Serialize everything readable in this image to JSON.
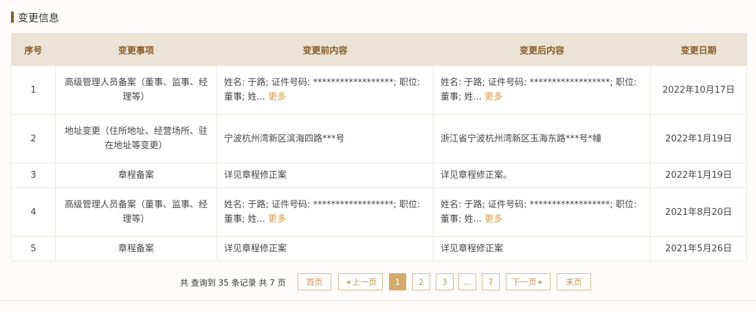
{
  "section": {
    "title": "变更信息"
  },
  "table": {
    "headers": {
      "index": "序号",
      "item": "变更事项",
      "before": "变更前内容",
      "after": "变更后内容",
      "date": "变更日期"
    },
    "more_label": "更多",
    "rows": [
      {
        "index": "1",
        "item": "高级管理人员备案（董事、监事、经理等）",
        "before": "姓名: 于路; 证件号码: ******************; 职位: 董事; 姓...",
        "after": "姓名: 于路; 证件号码: ******************; 职位: 董事; 姓...",
        "date": "2022年10月17日"
      },
      {
        "index": "2",
        "item": "地址变更（住所地址、经营场所、驻在地址等变更）",
        "before": "宁波杭州湾新区滨海四路***号",
        "after": "浙江省宁波杭州湾新区玉海东路***号*幢",
        "date": "2022年1月19日"
      },
      {
        "index": "3",
        "item": "章程备案",
        "before": "详见章程修正案",
        "after": "详见章程修正案。",
        "date": "2022年1月19日"
      },
      {
        "index": "4",
        "item": "高级管理人员备案（董事、监事、经理等）",
        "before": "姓名: 于路; 证件号码: ******************; 职位: 董事; 姓...",
        "after": "姓名: 于路; 证件号码: ******************; 职位: 董事; 姓...",
        "date": "2021年8月20日"
      },
      {
        "index": "5",
        "item": "章程备案",
        "before": "详见章程修正案",
        "after": "详见章程修正案",
        "date": "2021年5月26日"
      }
    ]
  },
  "pagination": {
    "summary": "共 查询到 35 条记录 共 7 页",
    "first": "首页",
    "prev": "上一页",
    "pages": [
      "1",
      "2",
      "3",
      "...",
      "7"
    ],
    "current_page": "1",
    "next": "下一页",
    "last": "末页"
  },
  "colors": {
    "accent": "#8a5a24",
    "header_bg": "#ebe3d6",
    "link": "#e09a3a",
    "page_active": "#d5aa6b"
  }
}
